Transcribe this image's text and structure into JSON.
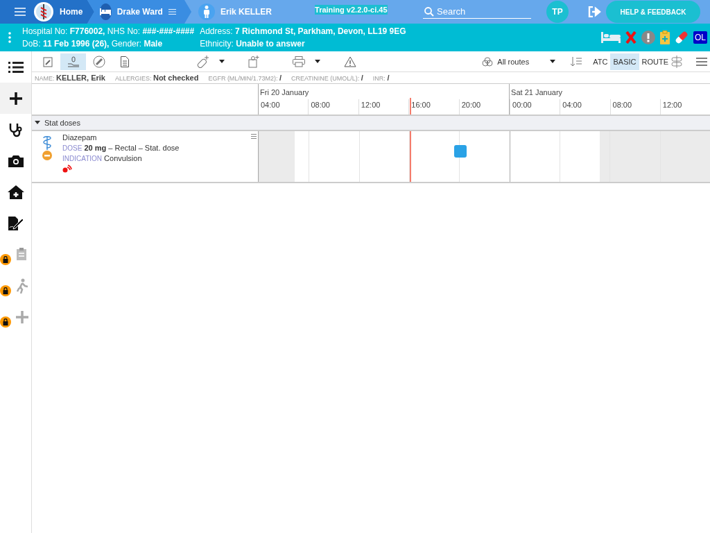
{
  "topbar": {
    "home": "Home",
    "ward": "Drake Ward",
    "patient": "Erik KELLER",
    "environment": "Training v2.2.0-ci.45",
    "search": {
      "placeholder": "Search"
    },
    "user_initials": "TP",
    "help_button": "HELP & FEEDBACK"
  },
  "patient_banner": {
    "hospital_no_label": "Hospital No:",
    "hospital_no": "F776002,",
    "nhs_no_label": "NHS No:",
    "nhs_no": "###-###-####",
    "address_label": "Address:",
    "address": "7 Richmond St, Parkham, Devon, LL19 9EG",
    "dob_label": "DoB:",
    "dob": "11 Feb 1996 (26),",
    "gender_label": "Gender:",
    "gender": "Male",
    "ethnicity_label": "Ethnicity:",
    "ethnicity": "Unable to answer",
    "ol_badge": "OL"
  },
  "sidebar": {
    "items": [
      {
        "kind": "list",
        "selected": false,
        "locked": false
      },
      {
        "kind": "plus",
        "selected": true,
        "locked": false
      },
      {
        "kind": "stethoscope",
        "selected": false,
        "locked": false
      },
      {
        "kind": "camera",
        "selected": false,
        "locked": false
      },
      {
        "kind": "home",
        "selected": false,
        "locked": false
      },
      {
        "kind": "sign",
        "selected": false,
        "locked": false
      },
      {
        "kind": "clipboard",
        "selected": false,
        "locked": true
      },
      {
        "kind": "walk",
        "selected": false,
        "locked": true
      },
      {
        "kind": "plus",
        "selected": false,
        "locked": true
      }
    ]
  },
  "view_tabs": [
    {
      "kind": "chart",
      "selected": false
    },
    {
      "kind": "hand",
      "selected": true
    },
    {
      "kind": "pill",
      "selected": false
    },
    {
      "kind": "document",
      "selected": false
    }
  ],
  "route_filter": "All routes",
  "grouping": [
    {
      "label": "ATC",
      "selected": false
    },
    {
      "label": "BASIC",
      "selected": true
    },
    {
      "label": "ROUTE",
      "selected": false
    }
  ],
  "info_bar": [
    {
      "label": "NAME:",
      "value": "KELLER, Erik"
    },
    {
      "label": "ALLERGIES:",
      "value": "Not checked"
    },
    {
      "label": "EGFR (ML/MIN/1.73M2):",
      "value": "/"
    },
    {
      "label": "CREATININE (UMOL/L):",
      "value": "/"
    },
    {
      "label": "INR:",
      "value": "/"
    }
  ],
  "timeline": {
    "days": [
      {
        "label": "Fri 20 January",
        "hours": [
          "04:00",
          "08:00",
          "12:00",
          "16:00",
          "20:00"
        ]
      },
      {
        "label": "Sat 21 January",
        "hours": [
          "00:00",
          "04:00",
          "08:00",
          "12:00"
        ]
      }
    ]
  },
  "groups": [
    {
      "title": "Stat doses",
      "expanded": true,
      "rows": [
        {
          "drug": "Diazepam",
          "dose_label": "DOSE",
          "dose": "20 mg",
          "route": "– Rectal – Stat. dose",
          "indication_label": "INDICATION",
          "indication": "Convulsion"
        }
      ]
    }
  ]
}
